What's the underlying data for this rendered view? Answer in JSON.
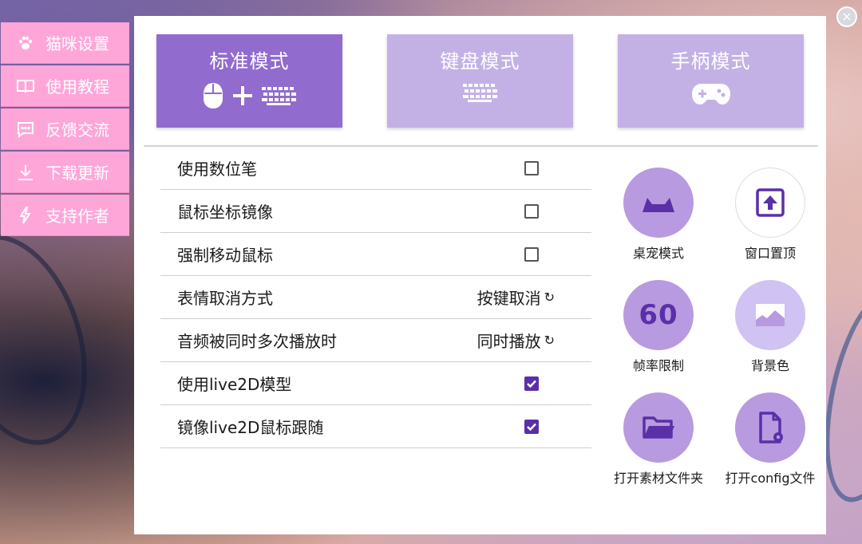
{
  "window": {
    "close_label": "×"
  },
  "sidebar": {
    "items": [
      {
        "label": "猫咪设置",
        "icon": "paw-icon"
      },
      {
        "label": "使用教程",
        "icon": "book-icon"
      },
      {
        "label": "反馈交流",
        "icon": "chat-icon"
      },
      {
        "label": "下载更新",
        "icon": "download-icon"
      },
      {
        "label": "支持作者",
        "icon": "bolt-icon"
      }
    ]
  },
  "modes": [
    {
      "label": "标准模式",
      "active": true,
      "icons": [
        "mouse-icon",
        "plus-icon",
        "keyboard-icon"
      ]
    },
    {
      "label": "键盘模式",
      "active": false,
      "icons": [
        "keyboard-icon"
      ]
    },
    {
      "label": "手柄模式",
      "active": false,
      "icons": [
        "gamepad-icon"
      ]
    }
  ],
  "settings": [
    {
      "label": "使用数位笔",
      "type": "checkbox",
      "checked": false
    },
    {
      "label": "鼠标坐标镜像",
      "type": "checkbox",
      "checked": false
    },
    {
      "label": "强制移动鼠标",
      "type": "checkbox",
      "checked": false
    },
    {
      "label": "表情取消方式",
      "type": "cycle",
      "value": "按键取消"
    },
    {
      "label": "音频被同时多次播放时",
      "type": "cycle",
      "value": "同时播放"
    },
    {
      "label": "使用live2D模型",
      "type": "checkbox",
      "checked": true
    },
    {
      "label": "镜像live2D鼠标跟随",
      "type": "checkbox",
      "checked": true
    }
  ],
  "tools": [
    {
      "label": "桌宠模式",
      "icon": "cat-ears-icon"
    },
    {
      "label": "窗口置顶",
      "icon": "pin-top-icon"
    },
    {
      "label": "帧率限制",
      "icon": "fps-60-icon",
      "icon_text": "60"
    },
    {
      "label": "背景色",
      "icon": "background-icon"
    },
    {
      "label": "打开素材文件夹",
      "icon": "folder-icon"
    },
    {
      "label": "打开config文件",
      "icon": "config-file-icon"
    }
  ],
  "colors": {
    "accent": "#916bcd",
    "accent_light": "#c3b1e6",
    "accent_dark": "#5b2fa8",
    "sidebar": "#ffa6d9",
    "circle": "#b89ae0",
    "circle_light": "#d0c2f2"
  }
}
